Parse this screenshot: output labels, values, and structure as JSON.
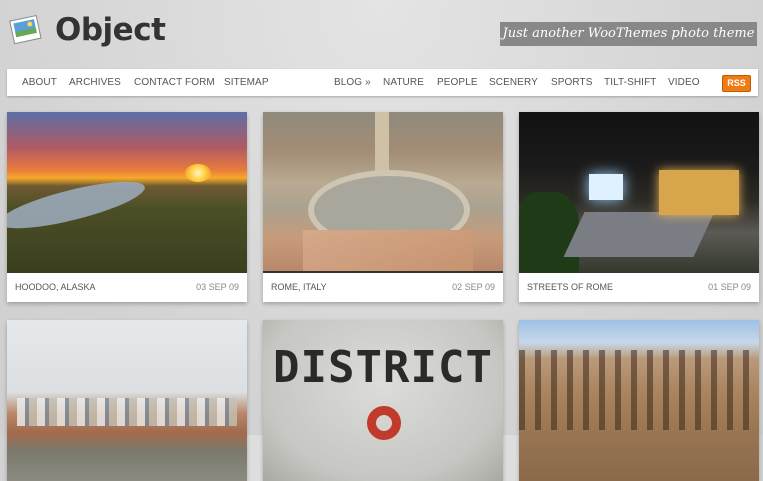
{
  "header": {
    "logo_text": "Object",
    "tagline": "Just another WooThemes photo theme"
  },
  "nav": {
    "left": [
      "ABOUT",
      "ARCHIVES",
      "CONTACT FORM",
      "SITEMAP"
    ],
    "right": [
      "BLOG »",
      "NATURE",
      "PEOPLE",
      "SCENERY",
      "SPORTS",
      "TILT-SHIFT",
      "VIDEO"
    ],
    "rss": "RSS"
  },
  "posts": [
    {
      "title": "HOODOO, ALASKA",
      "date": "03 SEP 09",
      "image": "sunset-landscape"
    },
    {
      "title": "ROME, ITALY",
      "date": "02 SEP 09",
      "image": "vatican-aerial"
    },
    {
      "title": "STREETS OF ROME",
      "date": "01 SEP 09",
      "image": "night-square"
    },
    {
      "title": "",
      "date": "",
      "image": "harbor-boats"
    },
    {
      "title": "",
      "date": "",
      "image": "district-sign",
      "image_text": "DISTRICT"
    },
    {
      "title": "",
      "date": "",
      "image": "colosseum"
    }
  ],
  "colors": {
    "tagline_bg": "#888888",
    "rss_orange": "#f07a14",
    "active_border": "#333333"
  }
}
